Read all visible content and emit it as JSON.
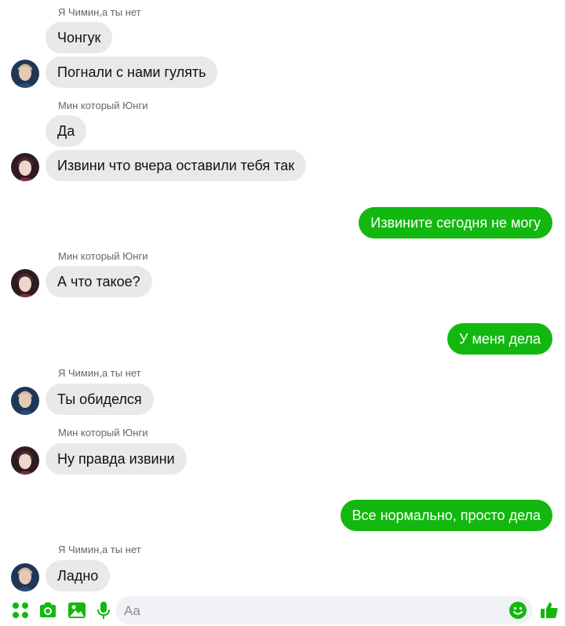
{
  "accent_color": "#12b80f",
  "incoming_bubble_color": "#e9e9ec",
  "senders": {
    "jimin": "Я Чимин,а ты нет",
    "yoongi": "Мин который Юнги"
  },
  "messages": [
    {
      "from": "jimin",
      "text": "Чонгук"
    },
    {
      "from": "jimin",
      "text": "Погнали с нами гулять"
    },
    {
      "from": "yoongi",
      "text": "Да"
    },
    {
      "from": "yoongi",
      "text": "Извини что вчера оставили тебя так"
    },
    {
      "from": "me",
      "text": "Извините сегодня не могу"
    },
    {
      "from": "yoongi",
      "text": "А что такое?"
    },
    {
      "from": "me",
      "text": "У меня дела"
    },
    {
      "from": "jimin",
      "text": "Ты обиделся"
    },
    {
      "from": "yoongi",
      "text": "Ну правда извини"
    },
    {
      "from": "me",
      "text": "Все нормально, просто дела"
    },
    {
      "from": "jimin",
      "text": "Ладно"
    }
  ],
  "composer": {
    "placeholder": "Aa",
    "icons": [
      "apps-icon",
      "camera-icon",
      "gallery-icon",
      "microphone-icon",
      "emoji-icon",
      "like-icon"
    ]
  }
}
